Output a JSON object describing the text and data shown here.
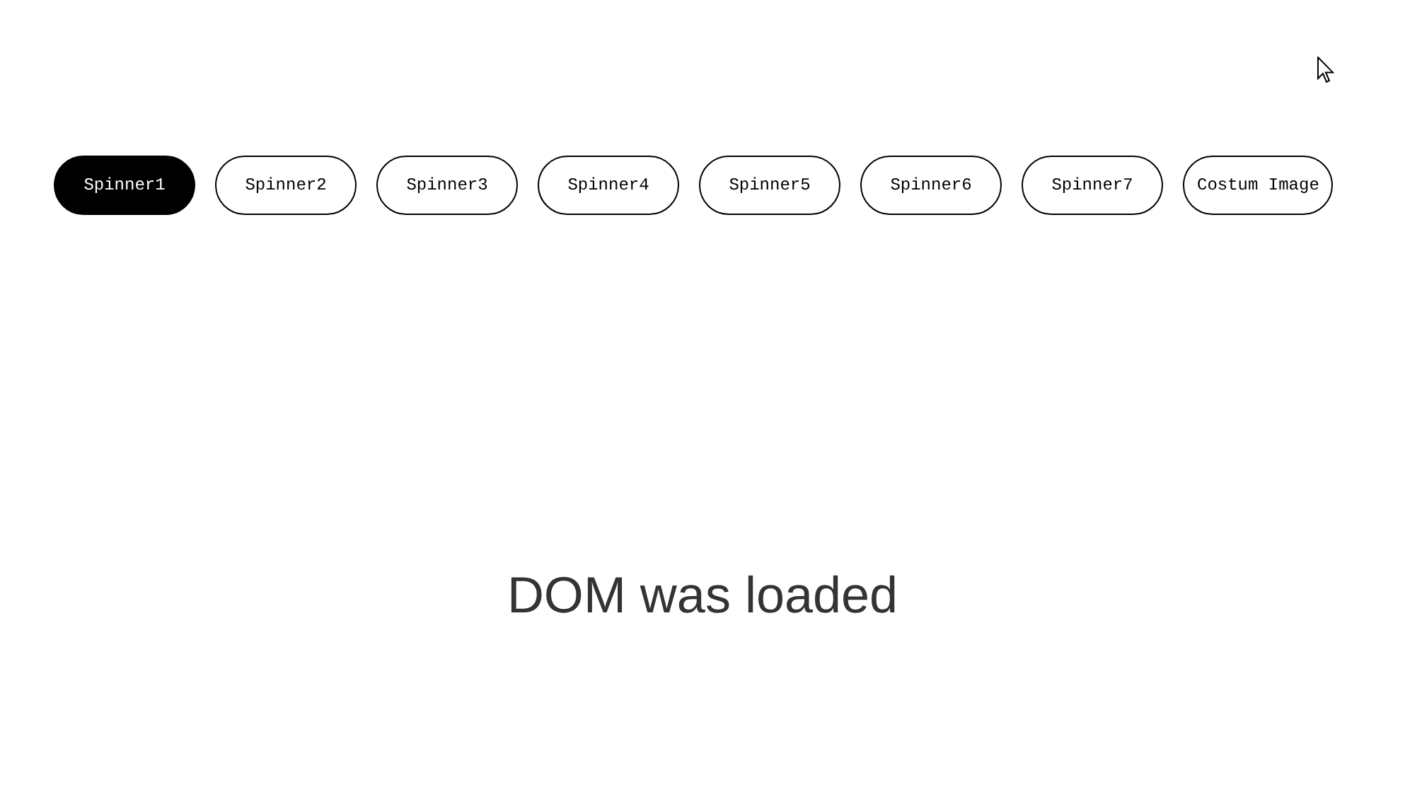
{
  "tabs": [
    {
      "label": "Spinner1",
      "selected": true
    },
    {
      "label": "Spinner2",
      "selected": false
    },
    {
      "label": "Spinner3",
      "selected": false
    },
    {
      "label": "Spinner4",
      "selected": false
    },
    {
      "label": "Spinner5",
      "selected": false
    },
    {
      "label": "Spinner6",
      "selected": false
    },
    {
      "label": "Spinner7",
      "selected": false
    },
    {
      "label": "Costum Image",
      "selected": false
    }
  ],
  "message": "DOM was loaded"
}
